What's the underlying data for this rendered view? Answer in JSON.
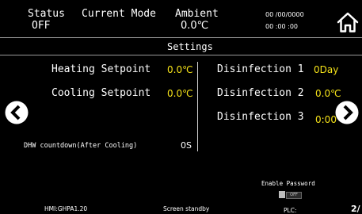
{
  "header": {
    "status_label": "Status",
    "status_value": "OFF",
    "mode_label": "Current Mode",
    "ambient_label": "Ambient",
    "ambient_value": "0.0℃",
    "date": "00 /00/0000",
    "time": "00 :00 :00",
    "home_icon": "home-icon"
  },
  "page_title": "Settings",
  "left": {
    "heating_label": "Heating Setpoint",
    "heating_value": "0.0℃",
    "cooling_label": "Cooling Setpoint",
    "cooling_value": "0.0℃",
    "dhw_label": "DHW countdown(After Cooling)",
    "dhw_value": "0S"
  },
  "right": {
    "dis1_label": "Disinfection 1",
    "dis1_value": "0Day",
    "dis2_label": "Disinfection 2",
    "dis2_value": "0.0℃",
    "dis3_label": "Disinfection 3",
    "dis3_value": "0:00"
  },
  "password": {
    "label": "Enable Password",
    "toggle_text": "OFF"
  },
  "nav": {
    "prev_icon": "chevron-left-icon",
    "next_icon": "chevron-right-icon"
  },
  "footer": {
    "hmi_version": "HMI:GHPA1.20",
    "standby": "Screen standby",
    "plc": "PLC:",
    "page": "2/"
  }
}
